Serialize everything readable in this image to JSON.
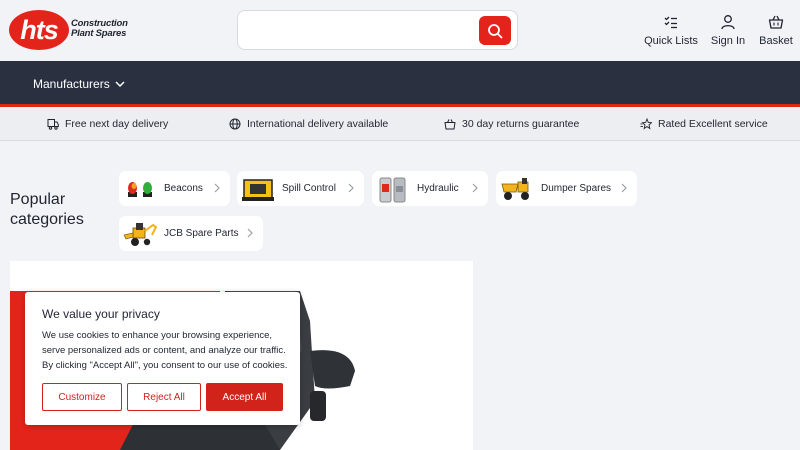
{
  "header": {
    "logo_text": "hts",
    "logo_sub_line1": "Construction",
    "logo_sub_line2": "Plant Spares",
    "search": {
      "placeholder": "",
      "value": ""
    },
    "links": [
      {
        "label": "Quick Lists",
        "icon": "checklist-icon"
      },
      {
        "label": "Sign In",
        "icon": "user-icon"
      },
      {
        "label": "Basket",
        "icon": "basket-icon"
      }
    ]
  },
  "nav": {
    "items": [
      {
        "label": "Manufacturers"
      }
    ]
  },
  "usp": {
    "items": [
      {
        "label": "Free next day delivery",
        "icon": "delivery-truck-icon"
      },
      {
        "label": "International delivery available",
        "icon": "globe-icon"
      },
      {
        "label": "30 day returns guarantee",
        "icon": "returns-basket-icon"
      },
      {
        "label": "Rated Excellent service",
        "icon": "rating-stars-icon"
      }
    ]
  },
  "popular": {
    "title": "Popular categories",
    "categories": [
      {
        "label": "Beacons"
      },
      {
        "label": "Spill Control"
      },
      {
        "label": "Hydraulic"
      },
      {
        "label": "Dumper Spares"
      },
      {
        "label": "JCB Spare Parts"
      }
    ]
  },
  "cookie": {
    "title": "We value your privacy",
    "body": "We use cookies to enhance your browsing experience, serve personalized ads or content, and analyze our traffic. By clicking \"Accept All\", you consent to our use of cookies.",
    "customize_label": "Customize",
    "reject_label": "Reject All",
    "accept_label": "Accept All"
  },
  "colors": {
    "brand_red": "#e3241b",
    "nav_bg": "#2a3040",
    "page_bg": "#f1f3f6"
  }
}
